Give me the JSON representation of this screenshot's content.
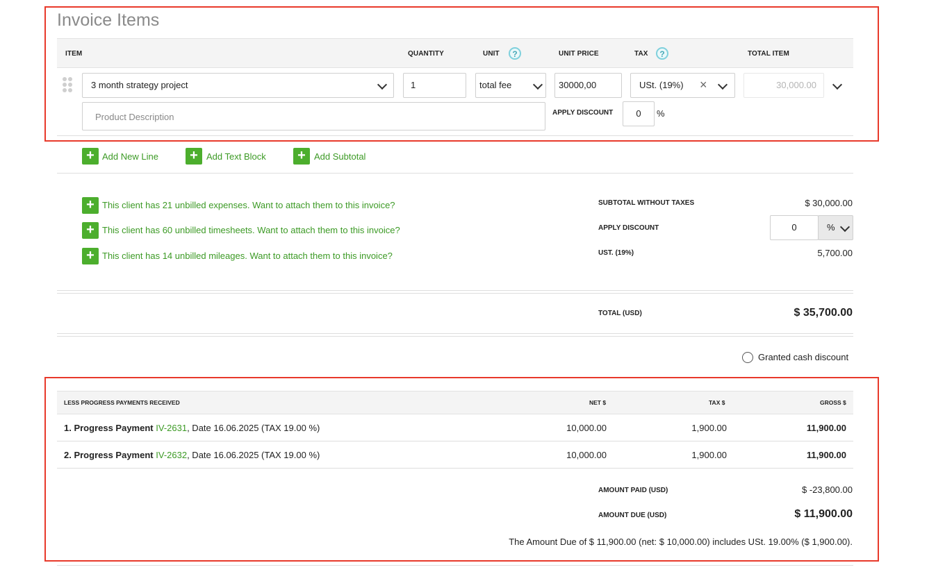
{
  "section_title": "Invoice Items",
  "table_headers": {
    "item": "ITEM",
    "quantity": "QUANTITY",
    "unit": "UNIT",
    "unit_price": "UNIT PRICE",
    "tax": "TAX",
    "total_item": "TOTAL ITEM"
  },
  "help_glyph": "?",
  "line_item": {
    "product": "3 month strategy project",
    "quantity": "1",
    "unit": "total fee",
    "unit_price": "30000,00",
    "tax": "USt. (19%)",
    "tax_clear": "×",
    "total": "30,000.00",
    "description_placeholder": "Product Description",
    "apply_discount_label": "APPLY DISCOUNT",
    "discount_value": "0",
    "discount_unit": "%"
  },
  "add_actions": {
    "add_new_line": "Add New Line",
    "add_text_block": "Add Text Block",
    "add_subtotal": "Add Subtotal",
    "plus": "+"
  },
  "unbilled": {
    "expenses": "This client has 21 unbilled expenses. Want to attach them to this invoice?",
    "timesheets": "This client has 60 unbilled timesheets. Want to attach them to this invoice?",
    "mileages": "This client has 14 unbilled mileages. Want to attach them to this invoice?"
  },
  "summary": {
    "subtotal_label": "SUBTOTAL WITHOUT TAXES",
    "subtotal_value": "$ 30,000.00",
    "discount_label": "APPLY DISCOUNT",
    "discount_value": "0",
    "discount_unit": "%",
    "tax_label": "UST. (19%)",
    "tax_value": "5,700.00",
    "total_label": "TOTAL (USD)",
    "total_value": "$ 35,700.00",
    "cash_discount_label": "Granted cash discount"
  },
  "progress": {
    "headers": {
      "description": "LESS PROGRESS PAYMENTS RECEIVED",
      "net": "NET $",
      "tax": "TAX $",
      "gross": "GROSS $"
    },
    "rows": [
      {
        "title": "1. Progress Payment",
        "invoice": "IV-2631",
        "details": ", Date 16.06.2025 (TAX 19.00 %)",
        "net": "10,000.00",
        "tax": "1,900.00",
        "gross": "11,900.00"
      },
      {
        "title": "2. Progress Payment",
        "invoice": "IV-2632",
        "details": ", Date 16.06.2025 (TAX 19.00 %)",
        "net": "10,000.00",
        "tax": "1,900.00",
        "gross": "11,900.00"
      }
    ],
    "amount_paid_label": "AMOUNT PAID (USD)",
    "amount_paid_value": "$ -23,800.00",
    "amount_due_label": "AMOUNT DUE (USD)",
    "amount_due_value": "$ 11,900.00",
    "note": "The Amount Due of $ 11,900.00 (net: $ 10,000.00) includes USt. 19.00% ($ 1,900.00)."
  },
  "colors": {
    "accent_green": "#4cae2d",
    "link_green": "#3c9a25",
    "highlight_red": "#e8392a",
    "help_cyan": "#7fd0dc"
  }
}
